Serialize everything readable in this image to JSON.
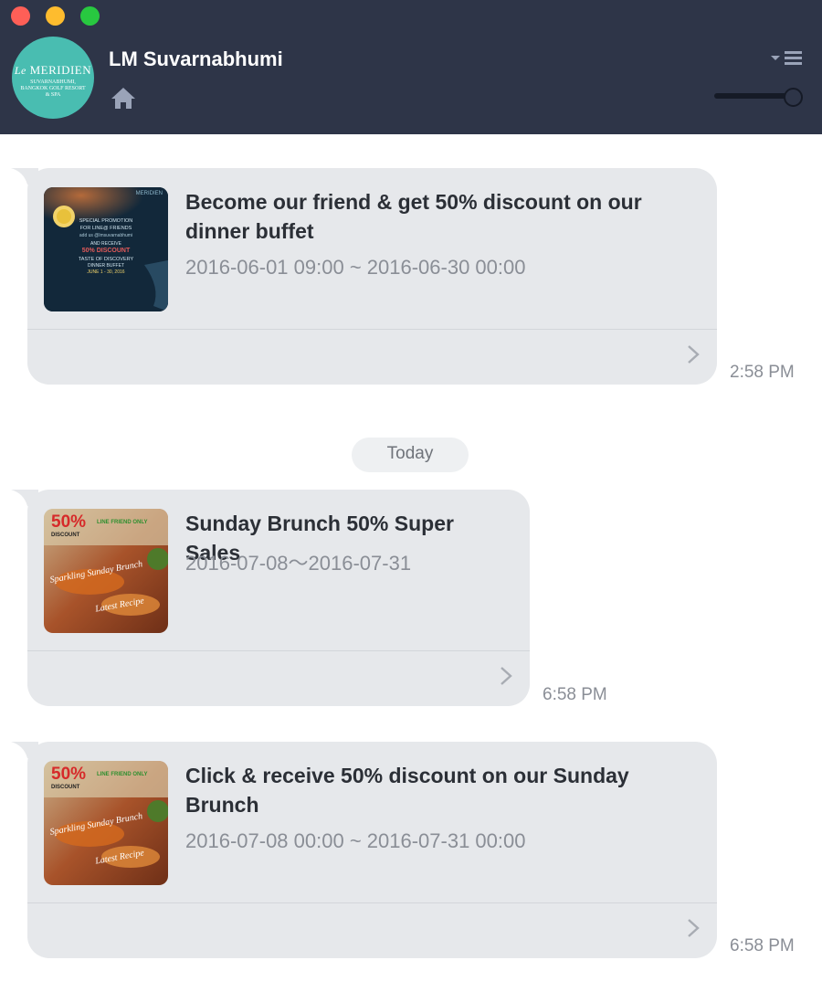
{
  "window": {
    "controls": [
      "close",
      "minimize",
      "maximize"
    ],
    "colors": {
      "red": "#fe5f57",
      "yellow": "#febc2e",
      "green": "#28c840"
    }
  },
  "header": {
    "title": "LM Suvarnabhumi",
    "avatar": {
      "brand_prefix": "Le",
      "brand_name": "MERIDIEN",
      "brand_sub": "SUVARNABHUMI, BANGKOK GOLF RESORT & SPA",
      "color": "#49bdb1"
    },
    "icons": {
      "home": "home-icon",
      "menu": "menu-icon",
      "slider": "zoom-slider"
    },
    "background": "#2e3548"
  },
  "chat": {
    "date_separator": "Today",
    "messages": [
      {
        "title": "Become our friend & get 50% discount on our dinner buffet",
        "date_range": "2016-06-01 09:00 ~ 2016-06-30 00:00",
        "time": "2:58 PM",
        "thumbnail": {
          "kind": "promo",
          "lines": {
            "brand": "MERIDIEN",
            "headline": "SPECIAL PROMOTION",
            "friends": "FOR LINE@ FRIENDS",
            "add": "add us @lmsuvarnabhumi",
            "receive": "AND RECEIVE",
            "discount": "50% DISCOUNT",
            "taste": "TASTE OF DISCOVERY",
            "buffet": "DINNER BUFFET",
            "dates": "JUNE 1 - 30, 2016"
          }
        }
      },
      {
        "title": "Sunday Brunch 50% Super Sales",
        "date_range": "2016-07-08～2016-07-31",
        "time": "6:58 PM",
        "thumbnail": {
          "kind": "brunch",
          "lines": {
            "pct": "50%",
            "discount": "DISCOUNT",
            "friend": "LINE FRIEND ONLY",
            "script1": "Sparkling Sunday Brunch",
            "script2": "Latest Recipe"
          }
        }
      },
      {
        "title": "Click & receive 50% discount on our Sunday Brunch",
        "date_range": "2016-07-08 00:00 ~ 2016-07-31 00:00",
        "time": "6:58 PM",
        "thumbnail": {
          "kind": "brunch",
          "lines": {
            "pct": "50%",
            "discount": "DISCOUNT",
            "friend": "LINE FRIEND ONLY",
            "script1": "Sparkling Sunday Brunch",
            "script2": "Latest Recipe"
          }
        }
      }
    ],
    "bubble_color": "#e6e8eb"
  }
}
